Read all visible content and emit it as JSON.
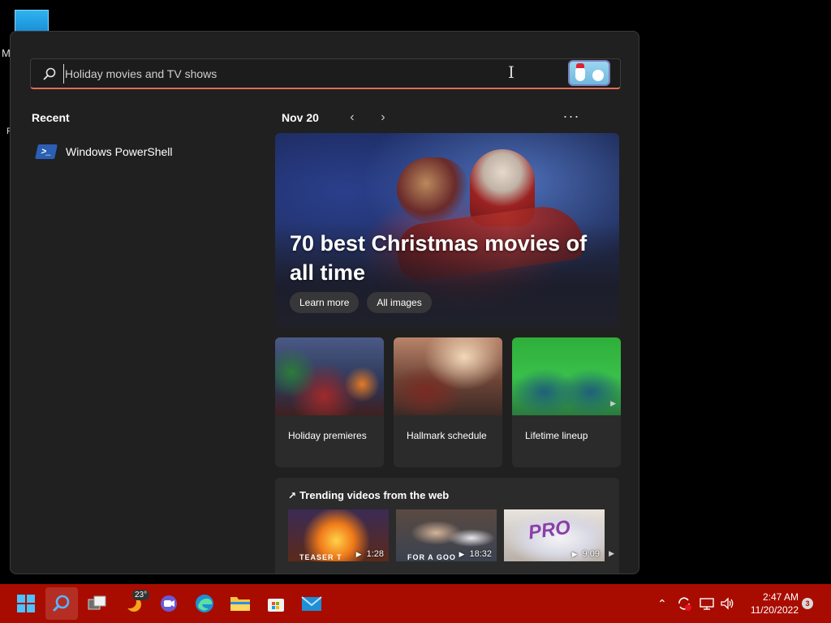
{
  "desktop": {
    "letter_m": "M",
    "letter_r": "R"
  },
  "search": {
    "placeholder": "Holiday movies and TV shows",
    "value": ""
  },
  "recent": {
    "title": "Recent",
    "items": [
      {
        "label": "Windows PowerShell",
        "icon": "powershell-icon"
      }
    ]
  },
  "highlights": {
    "date": "Nov 20",
    "prev_icon": "chevron-left-icon",
    "next_icon": "chevron-right-icon",
    "more_label": "···"
  },
  "hero": {
    "title": "70 best Christmas movies of all time",
    "buttons": [
      "Learn more",
      "All images"
    ]
  },
  "cards": [
    {
      "label": "Holiday premieres"
    },
    {
      "label": "Hallmark schedule"
    },
    {
      "label": "Lifetime lineup"
    }
  ],
  "trending": {
    "title": "Trending videos from the web",
    "videos": [
      {
        "caption": "TEASER T",
        "duration": "1:28"
      },
      {
        "caption": "FOR A GOO",
        "duration": "18:32"
      },
      {
        "caption": "PRO",
        "duration": "9:09"
      }
    ]
  },
  "taskbar": {
    "accent": "#a80c00",
    "apps": [
      "start-icon",
      "search-icon",
      "task-view-icon",
      "weather-icon",
      "chat-icon",
      "edge-icon",
      "file-explorer-icon",
      "store-icon",
      "mail-icon"
    ],
    "weather_temp": "23°"
  },
  "tray": {
    "time": "2:47 AM",
    "date": "11/20/2022",
    "notifications": "3"
  }
}
